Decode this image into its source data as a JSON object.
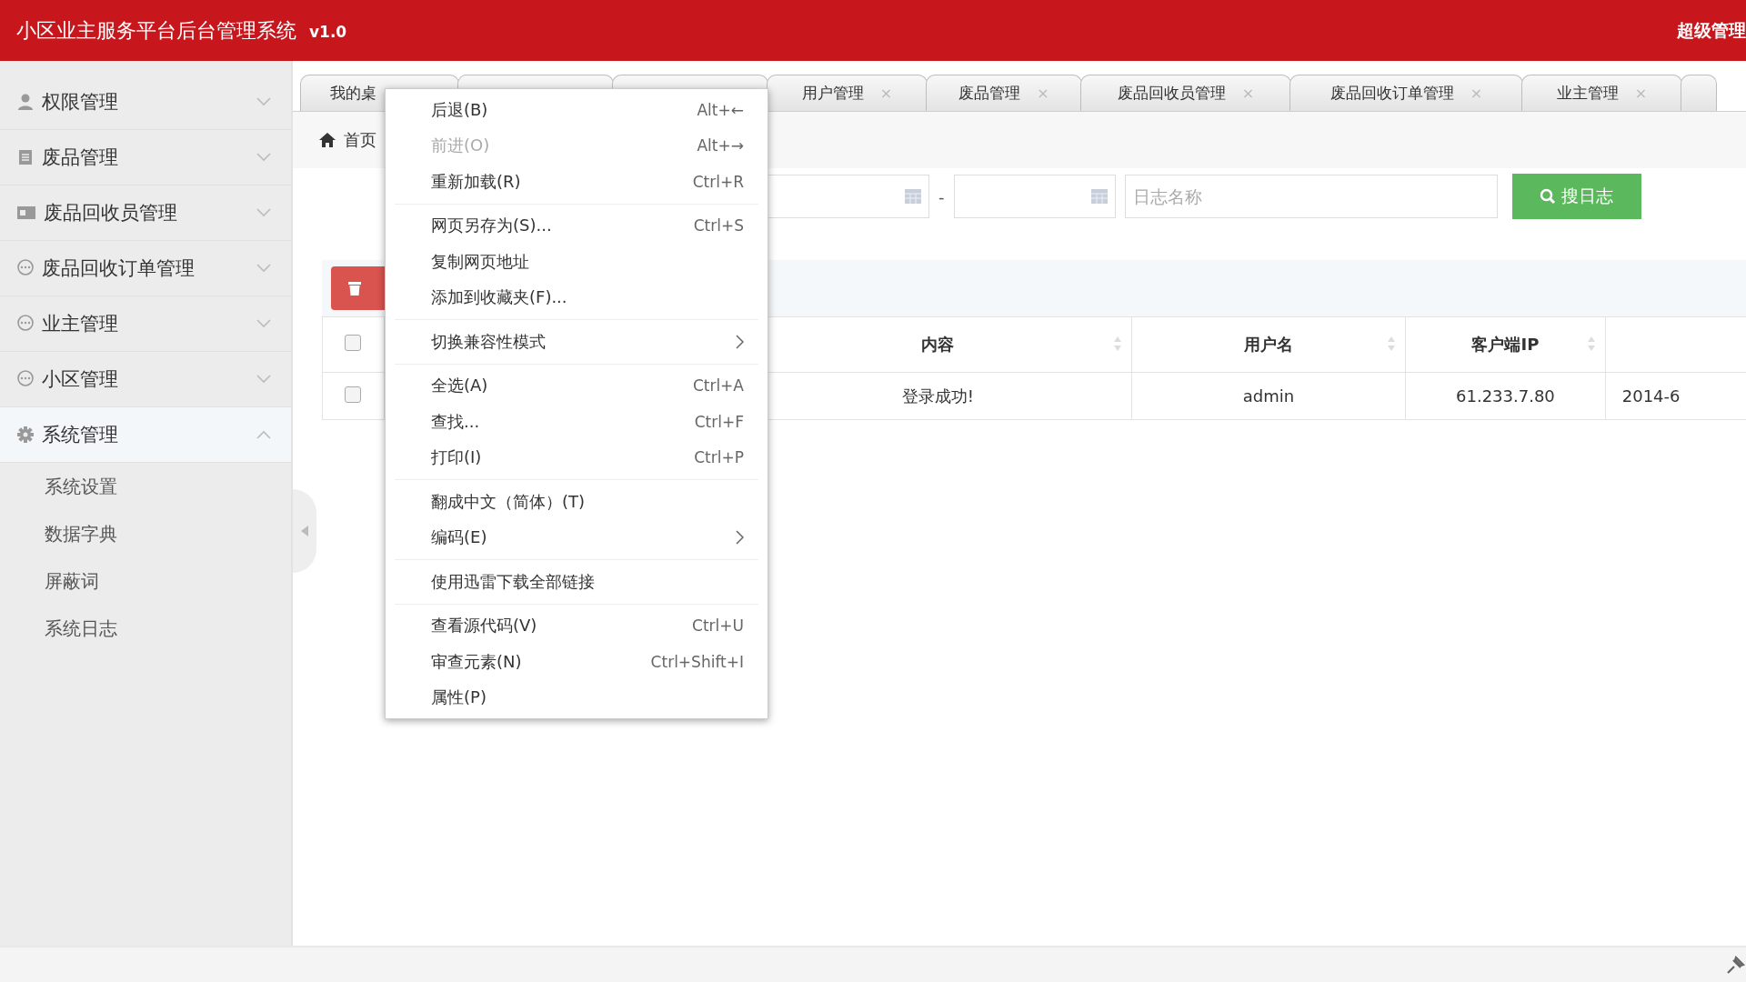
{
  "header": {
    "title": "小区业主服务平台后台管理系统",
    "version": "v1.0",
    "user": "超级管理"
  },
  "sidebar": {
    "items": [
      {
        "label": "权限管理",
        "expanded": false
      },
      {
        "label": "废品管理",
        "expanded": false
      },
      {
        "label": "废品回收员管理",
        "expanded": false
      },
      {
        "label": "废品回收订单管理",
        "expanded": false
      },
      {
        "label": "业主管理",
        "expanded": false
      },
      {
        "label": "小区管理",
        "expanded": false
      },
      {
        "label": "系统管理",
        "expanded": true,
        "children": [
          "系统设置",
          "数据字典",
          "屏蔽词",
          "系统日志"
        ]
      }
    ]
  },
  "tabs": [
    {
      "label": "我的桌",
      "selected": false
    },
    {
      "selected": false
    },
    {
      "selected": false
    },
    {
      "label": "用户管理",
      "close": "×",
      "selected": false
    },
    {
      "label": "废品管理",
      "close": "×",
      "selected": false
    },
    {
      "label": "废品回收员管理",
      "close": "×",
      "selected": false
    },
    {
      "label": "废品回收订单管理",
      "close": "×",
      "selected": false
    },
    {
      "label": "业主管理",
      "close": "×",
      "selected": false
    }
  ],
  "breadcrumb": "首页",
  "filters": {
    "separator": "-",
    "name_placeholder": "日志名称",
    "search_button": "搜日志"
  },
  "table": {
    "columns": [
      {
        "label": "内容",
        "sortable": true
      },
      {
        "label": "用户名",
        "sortable": true
      },
      {
        "label": "客户端IP",
        "sortable": true
      }
    ],
    "rows": [
      {
        "checked": false,
        "cells": [
          "登录成功!",
          "admin",
          "61.233.7.80",
          "2014-6"
        ]
      }
    ],
    "header_checked": false
  },
  "context_menu": {
    "groups": [
      [
        {
          "label": "后退(B)",
          "shortcut": "Alt+←",
          "disabled": false,
          "submenu": false
        },
        {
          "label": "前进(O)",
          "shortcut": "Alt+→",
          "disabled": true,
          "submenu": false
        },
        {
          "label": "重新加载(R)",
          "shortcut": "Ctrl+R",
          "disabled": false,
          "submenu": false
        }
      ],
      [
        {
          "label": "网页另存为(S)...",
          "shortcut": "Ctrl+S",
          "disabled": false,
          "submenu": false
        },
        {
          "label": "复制网页地址",
          "disabled": false,
          "submenu": false
        },
        {
          "label": "添加到收藏夹(F)...",
          "disabled": false,
          "submenu": false
        }
      ],
      [
        {
          "label": "切换兼容性模式",
          "disabled": false,
          "submenu": true
        }
      ],
      [
        {
          "label": "全选(A)",
          "shortcut": "Ctrl+A",
          "disabled": false,
          "submenu": false
        },
        {
          "label": "查找...",
          "shortcut": "Ctrl+F",
          "disabled": false,
          "submenu": false
        },
        {
          "label": "打印(I)",
          "shortcut": "Ctrl+P",
          "disabled": false,
          "submenu": false
        }
      ],
      [
        {
          "label": "翻成中文（简体）(T)",
          "disabled": false,
          "submenu": false
        },
        {
          "label": "编码(E)",
          "disabled": false,
          "submenu": true
        }
      ],
      [
        {
          "label": "使用迅雷下载全部链接",
          "disabled": false,
          "submenu": false
        }
      ],
      [
        {
          "label": "查看源代码(V)",
          "shortcut": "Ctrl+U",
          "disabled": false,
          "submenu": false
        },
        {
          "label": "审查元素(N)",
          "shortcut": "Ctrl+Shift+I",
          "disabled": false,
          "submenu": false
        },
        {
          "label": "属性(P)",
          "disabled": false,
          "submenu": false
        }
      ]
    ]
  }
}
